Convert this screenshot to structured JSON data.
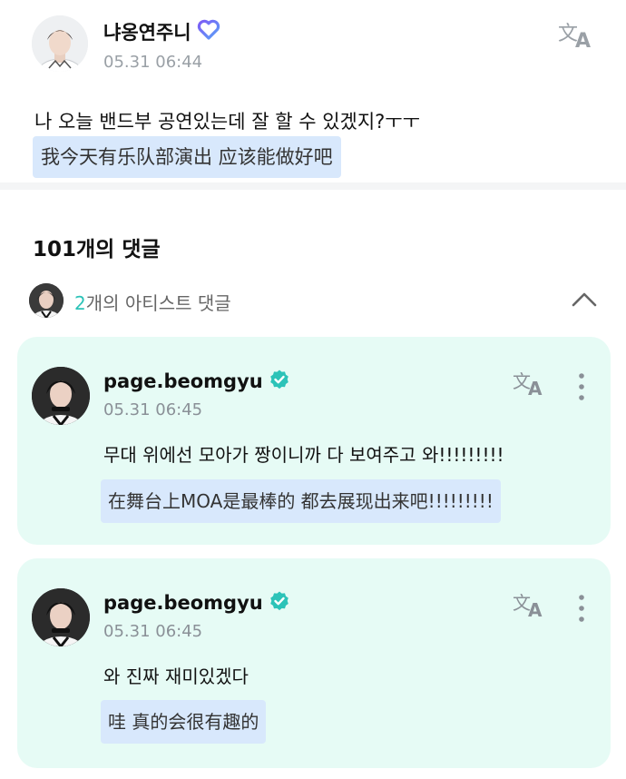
{
  "post": {
    "author_name": "냐옹연주니",
    "timestamp": "05.31 06:44",
    "text": "나 오늘 밴드부 공연있는데 잘 할 수 있겠지?ㅜㅜ",
    "translation": "我今天有乐队部演出 应该能做好吧"
  },
  "comments_header": {
    "count_label": "101개의 댓글"
  },
  "artist_comments_bar": {
    "count": "2",
    "label": "개의 아티스트 댓글"
  },
  "comments": [
    {
      "author_name": "page.beomgyu",
      "timestamp": "05.31 06:45",
      "text": "무대 위에선 모아가 짱이니까 다 보여주고 와!!!!!!!!!",
      "translation": "在舞台上MOA是最棒的 都去展现出来吧!!!!!!!!!"
    },
    {
      "author_name": "page.beomgyu",
      "timestamp": "05.31 06:45",
      "text": "와 진짜 재미있겠다",
      "translation": "哇 真的会很有趣的"
    }
  ],
  "colors": {
    "accent_teal": "#2cc3b8",
    "card_background": "#e6fbf5",
    "translation_background": "#d8e8fc",
    "fan_badge": "#8a6cf0",
    "verified_badge": "#2cc3b8"
  },
  "icons": {
    "fan_badge": "heart-badge-icon",
    "verified": "verified-check-icon",
    "translate": "translate-icon",
    "more": "more-vertical-icon",
    "collapse": "chevron-up-icon"
  }
}
